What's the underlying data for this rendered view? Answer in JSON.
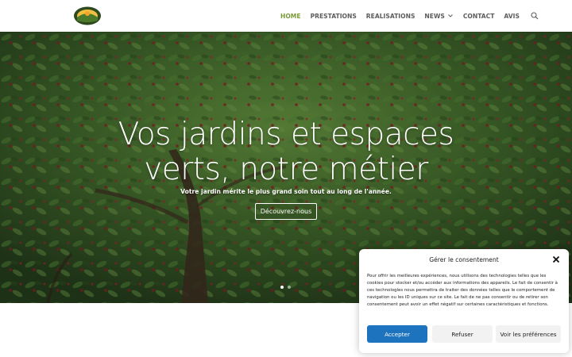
{
  "header": {
    "nav": [
      {
        "label": "HOME",
        "active": true
      },
      {
        "label": "PRESTATIONS"
      },
      {
        "label": "REALISATIONS"
      },
      {
        "label": "NEWS",
        "has_dropdown": true
      },
      {
        "label": "CONTACT"
      },
      {
        "label": "AVIS"
      }
    ],
    "search_icon": "search-icon",
    "accent_color": "#7a9a3a"
  },
  "hero": {
    "title_line1": "Vos jardins et espaces",
    "title_line2": "verts, notre métier",
    "subtitle": "Votre jardin mérite le plus grand soin tout au long de l'année.",
    "button_label": "Découvrez-nous",
    "slides": 2,
    "active_slide": 1
  },
  "consent": {
    "title": "Gérer le consentement",
    "text": "Pour offrir les meilleures expériences, nous utilisons des technologies telles que les cookies pour stocker et/ou accéder aux informations des appareils. Le fait de consentir à ces technologies nous permettra de traiter des données telles que le comportement de navigation ou les ID uniques sur ce site. Le fait de ne pas consentir ou de retirer son consentement peut avoir un effet négatif sur certaines caractéristiques et fonctions.",
    "accept_label": "Accepter",
    "refuse_label": "Refuser",
    "preferences_label": "Voir les préférences",
    "accept_color": "#1e73be"
  }
}
